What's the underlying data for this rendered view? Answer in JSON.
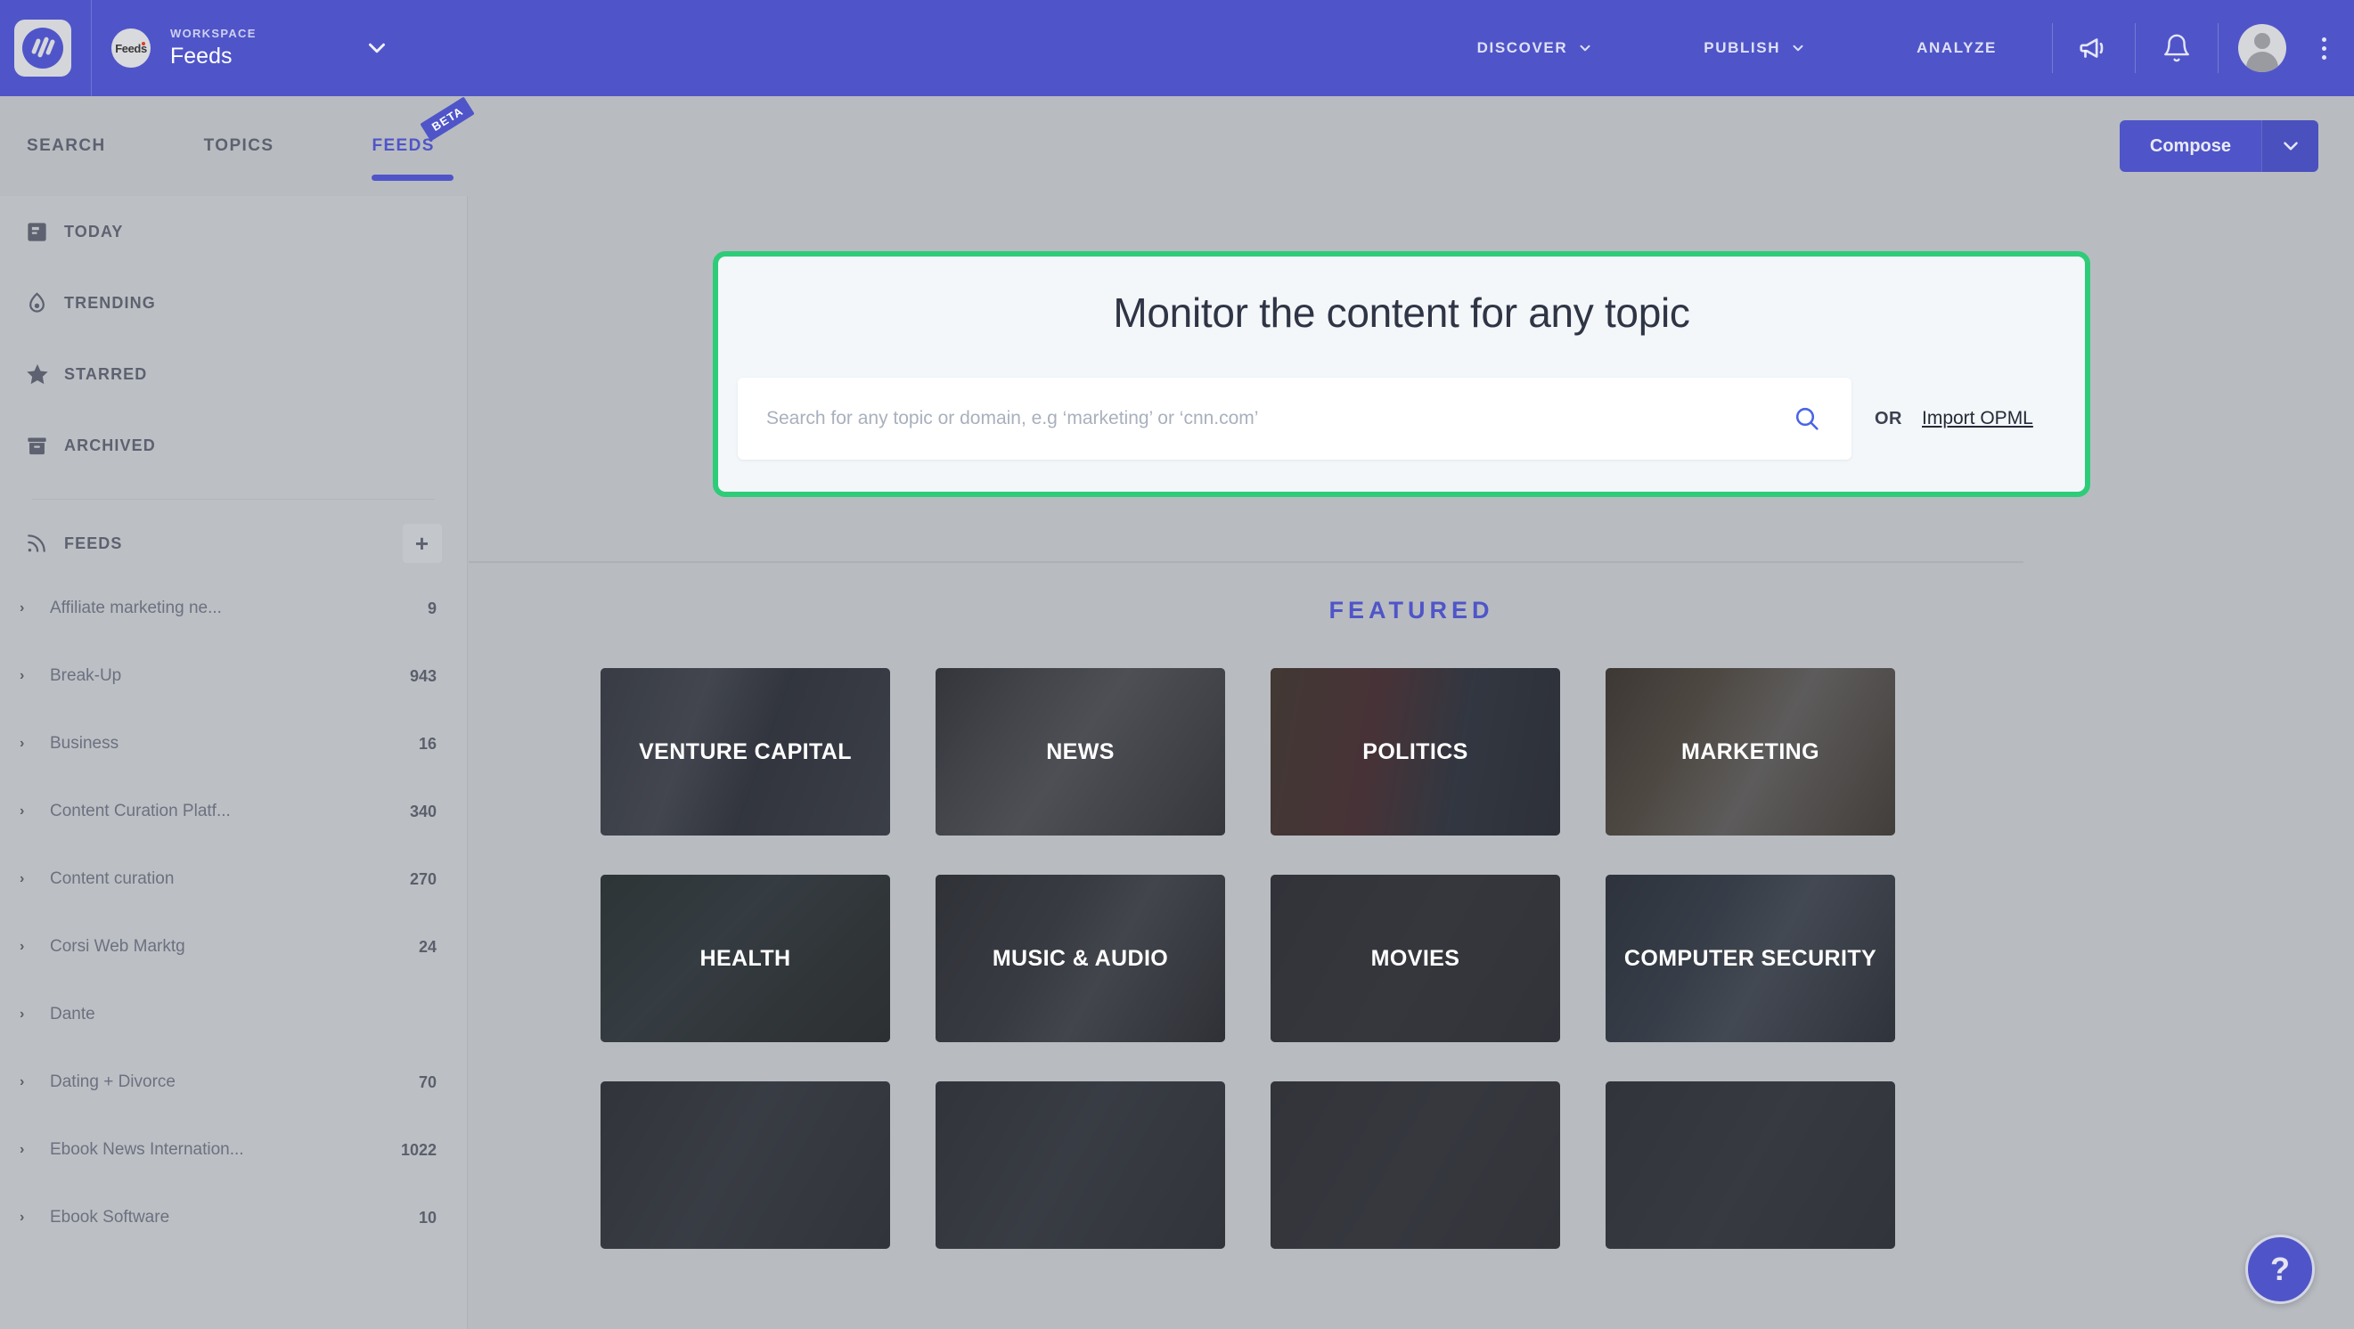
{
  "topnav": {
    "logo_icon": "app-logo-icon",
    "workspace_label": "WORKSPACE",
    "workspace_name": "Feeds",
    "workspace_avatar_text": "Feeds",
    "menu": [
      {
        "label": "DISCOVER",
        "has_caret": true
      },
      {
        "label": "PUBLISH",
        "has_caret": true
      },
      {
        "label": "ANALYZE",
        "has_caret": false
      }
    ],
    "icons": [
      "megaphone-icon",
      "bell-icon",
      "avatar",
      "kebab-menu-icon"
    ]
  },
  "subnav": {
    "tabs": [
      {
        "label": "SEARCH",
        "active": false,
        "badge": ""
      },
      {
        "label": "TOPICS",
        "active": false,
        "badge": ""
      },
      {
        "label": "FEEDS",
        "active": true,
        "badge": "BETA"
      }
    ],
    "compose_label": "Compose"
  },
  "sidebar": {
    "nav": [
      {
        "label": "TODAY",
        "icon": "today-icon"
      },
      {
        "label": "TRENDING",
        "icon": "flame-icon"
      },
      {
        "label": "STARRED",
        "icon": "star-icon"
      },
      {
        "label": "ARCHIVED",
        "icon": "archive-icon"
      }
    ],
    "feeds_header": "FEEDS",
    "add_label": "+",
    "feeds": [
      {
        "name": "Affiliate marketing ne...",
        "count": "9"
      },
      {
        "name": "Break-Up",
        "count": "943"
      },
      {
        "name": "Business",
        "count": "16"
      },
      {
        "name": "Content Curation Platf...",
        "count": "340"
      },
      {
        "name": "Content curation",
        "count": "270"
      },
      {
        "name": "Corsi Web Marktg",
        "count": "24"
      },
      {
        "name": "Dante",
        "count": ""
      },
      {
        "name": "Dating + Divorce",
        "count": "70"
      },
      {
        "name": "Ebook News Internation...",
        "count": "1022"
      },
      {
        "name": "Ebook Software",
        "count": "10"
      }
    ]
  },
  "modal": {
    "title": "Monitor the content for any topic",
    "search_placeholder": "Search for any topic or domain, e.g ‘marketing’ or ‘cnn.com’",
    "search_value": "",
    "search_icon": "search-icon",
    "or_label": "OR",
    "import_label": "Import OPML",
    "border_color": "#2ecc79"
  },
  "featured": {
    "heading": "FEATURED",
    "accent_color": "#4f55c8",
    "cards": [
      {
        "label": "VENTURE CAPITAL",
        "bg": "bg-vc"
      },
      {
        "label": "NEWS",
        "bg": "bg-news"
      },
      {
        "label": "POLITICS",
        "bg": "bg-pol"
      },
      {
        "label": "MARKETING",
        "bg": "bg-mkt"
      },
      {
        "label": "HEALTH",
        "bg": "bg-health"
      },
      {
        "label": "MUSIC & AUDIO",
        "bg": "bg-music"
      },
      {
        "label": "MOVIES",
        "bg": "bg-movies"
      },
      {
        "label": "COMPUTER SECURITY",
        "bg": "bg-sec"
      },
      {
        "label": "",
        "bg": "bg-r3a"
      },
      {
        "label": "",
        "bg": "bg-r3b"
      },
      {
        "label": "",
        "bg": "bg-r3c"
      },
      {
        "label": "",
        "bg": "bg-r3d"
      }
    ]
  },
  "help": {
    "label": "?"
  }
}
